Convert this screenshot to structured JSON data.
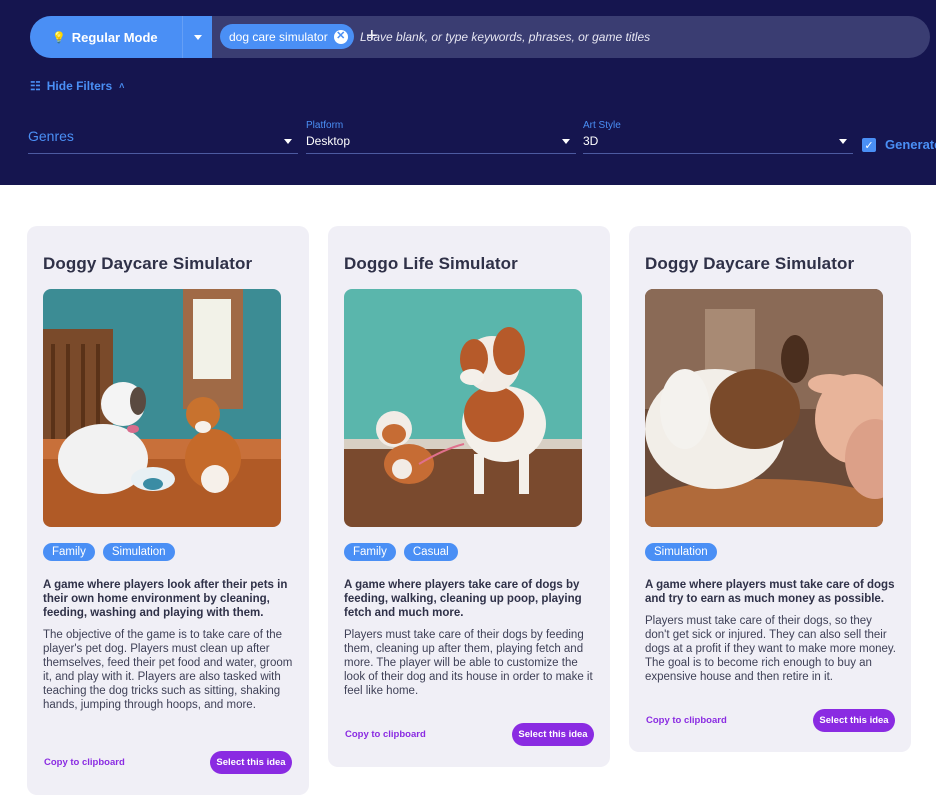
{
  "search": {
    "mode_label": "Regular Mode",
    "chip_label": "dog care simulator",
    "placeholder": "Leave blank, or type keywords, phrases, or game titles"
  },
  "filters": {
    "toggle_label": "Hide Filters",
    "genres_label": "Genres",
    "platform_label": "Platform",
    "platform_value": "Desktop",
    "artstyle_label": "Art Style",
    "artstyle_value": "3D",
    "generate_label": "Generate"
  },
  "cards": [
    {
      "title": "Doggy Daycare Simulator",
      "tags": [
        "Family",
        "Simulation"
      ],
      "summary": "A game where players look after their pets in their own home environment by cleaning, feeding, washing and playing with them.",
      "description": "The objective of the game is to take care of the player's pet dog. Players must clean up after themselves, feed their pet food and water, groom it, and play with it. Players are also tasked with teaching the dog tricks such as sitting, shaking hands, jumping through hoops, and more.",
      "copy_label": "Copy to clipboard",
      "select_label": "Select this idea"
    },
    {
      "title": "Doggo Life Simulator",
      "tags": [
        "Family",
        "Casual"
      ],
      "summary": "A game where players take care of dogs by feeding, walking, cleaning up poop, playing fetch and much more.",
      "description": "Players must take care of their dogs by feeding them, cleaning up after them, playing fetch and more. The player will be able to customize the look of their dog and its house in order to make it feel like home.",
      "copy_label": "Copy to clipboard",
      "select_label": "Select this idea"
    },
    {
      "title": "Doggy Daycare Simulator",
      "tags": [
        "Simulation"
      ],
      "summary": "A game where players must take care of dogs and try to earn as much money as possible.",
      "description": "Players must take care of their dogs, so they don't get sick or injured. They can also sell their dogs at a profit if they want to make more money. The goal is to become rich enough to buy an expensive house and then retire in it.",
      "copy_label": "Copy to clipboard",
      "select_label": "Select this idea"
    }
  ],
  "colors": {
    "header_bg": "#15154f",
    "accent_blue": "#4a8ff5",
    "accent_purple": "#8a2be2",
    "card_bg": "#f0eff6"
  }
}
